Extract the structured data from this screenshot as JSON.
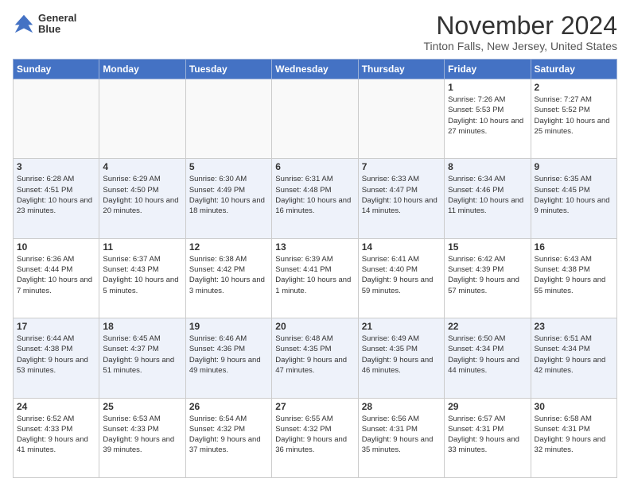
{
  "header": {
    "logo_line1": "General",
    "logo_line2": "Blue",
    "month_title": "November 2024",
    "subtitle": "Tinton Falls, New Jersey, United States"
  },
  "weekdays": [
    "Sunday",
    "Monday",
    "Tuesday",
    "Wednesday",
    "Thursday",
    "Friday",
    "Saturday"
  ],
  "weeks": [
    [
      {
        "day": "",
        "info": ""
      },
      {
        "day": "",
        "info": ""
      },
      {
        "day": "",
        "info": ""
      },
      {
        "day": "",
        "info": ""
      },
      {
        "day": "",
        "info": ""
      },
      {
        "day": "1",
        "info": "Sunrise: 7:26 AM\nSunset: 5:53 PM\nDaylight: 10 hours and 27 minutes."
      },
      {
        "day": "2",
        "info": "Sunrise: 7:27 AM\nSunset: 5:52 PM\nDaylight: 10 hours and 25 minutes."
      }
    ],
    [
      {
        "day": "3",
        "info": "Sunrise: 6:28 AM\nSunset: 4:51 PM\nDaylight: 10 hours and 23 minutes."
      },
      {
        "day": "4",
        "info": "Sunrise: 6:29 AM\nSunset: 4:50 PM\nDaylight: 10 hours and 20 minutes."
      },
      {
        "day": "5",
        "info": "Sunrise: 6:30 AM\nSunset: 4:49 PM\nDaylight: 10 hours and 18 minutes."
      },
      {
        "day": "6",
        "info": "Sunrise: 6:31 AM\nSunset: 4:48 PM\nDaylight: 10 hours and 16 minutes."
      },
      {
        "day": "7",
        "info": "Sunrise: 6:33 AM\nSunset: 4:47 PM\nDaylight: 10 hours and 14 minutes."
      },
      {
        "day": "8",
        "info": "Sunrise: 6:34 AM\nSunset: 4:46 PM\nDaylight: 10 hours and 11 minutes."
      },
      {
        "day": "9",
        "info": "Sunrise: 6:35 AM\nSunset: 4:45 PM\nDaylight: 10 hours and 9 minutes."
      }
    ],
    [
      {
        "day": "10",
        "info": "Sunrise: 6:36 AM\nSunset: 4:44 PM\nDaylight: 10 hours and 7 minutes."
      },
      {
        "day": "11",
        "info": "Sunrise: 6:37 AM\nSunset: 4:43 PM\nDaylight: 10 hours and 5 minutes."
      },
      {
        "day": "12",
        "info": "Sunrise: 6:38 AM\nSunset: 4:42 PM\nDaylight: 10 hours and 3 minutes."
      },
      {
        "day": "13",
        "info": "Sunrise: 6:39 AM\nSunset: 4:41 PM\nDaylight: 10 hours and 1 minute."
      },
      {
        "day": "14",
        "info": "Sunrise: 6:41 AM\nSunset: 4:40 PM\nDaylight: 9 hours and 59 minutes."
      },
      {
        "day": "15",
        "info": "Sunrise: 6:42 AM\nSunset: 4:39 PM\nDaylight: 9 hours and 57 minutes."
      },
      {
        "day": "16",
        "info": "Sunrise: 6:43 AM\nSunset: 4:38 PM\nDaylight: 9 hours and 55 minutes."
      }
    ],
    [
      {
        "day": "17",
        "info": "Sunrise: 6:44 AM\nSunset: 4:38 PM\nDaylight: 9 hours and 53 minutes."
      },
      {
        "day": "18",
        "info": "Sunrise: 6:45 AM\nSunset: 4:37 PM\nDaylight: 9 hours and 51 minutes."
      },
      {
        "day": "19",
        "info": "Sunrise: 6:46 AM\nSunset: 4:36 PM\nDaylight: 9 hours and 49 minutes."
      },
      {
        "day": "20",
        "info": "Sunrise: 6:48 AM\nSunset: 4:35 PM\nDaylight: 9 hours and 47 minutes."
      },
      {
        "day": "21",
        "info": "Sunrise: 6:49 AM\nSunset: 4:35 PM\nDaylight: 9 hours and 46 minutes."
      },
      {
        "day": "22",
        "info": "Sunrise: 6:50 AM\nSunset: 4:34 PM\nDaylight: 9 hours and 44 minutes."
      },
      {
        "day": "23",
        "info": "Sunrise: 6:51 AM\nSunset: 4:34 PM\nDaylight: 9 hours and 42 minutes."
      }
    ],
    [
      {
        "day": "24",
        "info": "Sunrise: 6:52 AM\nSunset: 4:33 PM\nDaylight: 9 hours and 41 minutes."
      },
      {
        "day": "25",
        "info": "Sunrise: 6:53 AM\nSunset: 4:33 PM\nDaylight: 9 hours and 39 minutes."
      },
      {
        "day": "26",
        "info": "Sunrise: 6:54 AM\nSunset: 4:32 PM\nDaylight: 9 hours and 37 minutes."
      },
      {
        "day": "27",
        "info": "Sunrise: 6:55 AM\nSunset: 4:32 PM\nDaylight: 9 hours and 36 minutes."
      },
      {
        "day": "28",
        "info": "Sunrise: 6:56 AM\nSunset: 4:31 PM\nDaylight: 9 hours and 35 minutes."
      },
      {
        "day": "29",
        "info": "Sunrise: 6:57 AM\nSunset: 4:31 PM\nDaylight: 9 hours and 33 minutes."
      },
      {
        "day": "30",
        "info": "Sunrise: 6:58 AM\nSunset: 4:31 PM\nDaylight: 9 hours and 32 minutes."
      }
    ]
  ]
}
